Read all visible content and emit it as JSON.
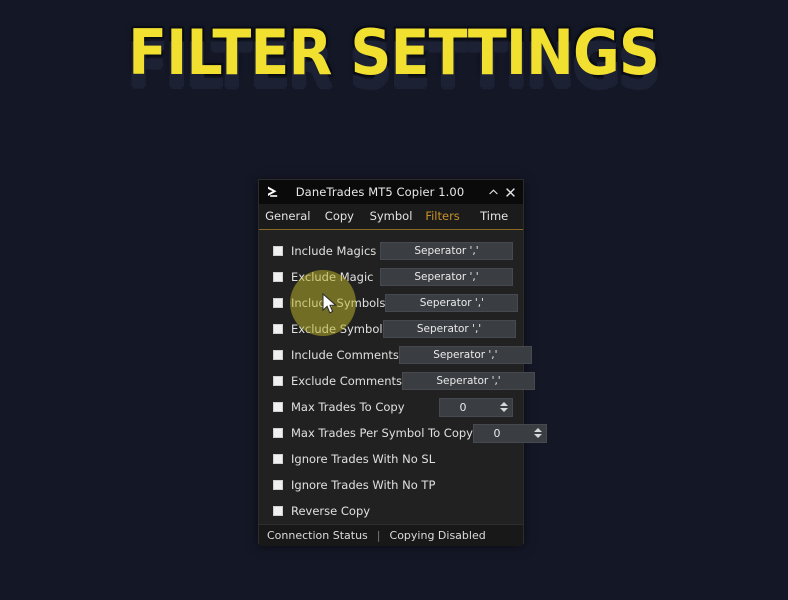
{
  "banner": {
    "title": "FILTER SETTINGS",
    "color": "#f2e030",
    "shadow_color": "#1d2134"
  },
  "page": {
    "background": "#141726"
  },
  "window": {
    "titlebar": {
      "logo_icon": "chevron-right-logo-icon",
      "title": "DaneTrades MT5 Copier 1.00",
      "collapse_icon": "chevron-up-icon",
      "close_icon": "close-x-icon"
    },
    "tabs": [
      {
        "label": "General",
        "active": false
      },
      {
        "label": "Copy",
        "active": false
      },
      {
        "label": "Symbol",
        "active": false
      },
      {
        "label": "Filters",
        "active": true
      },
      {
        "label": "Time",
        "active": false
      }
    ],
    "active_tab_color": "#c8922a",
    "background": "#212121",
    "rows": [
      {
        "label": "Include Magics",
        "checked": false,
        "control": "text",
        "value": "Seperator ','"
      },
      {
        "label": "Exclude Magic",
        "checked": false,
        "control": "text",
        "value": "Seperator ','"
      },
      {
        "label": "Include Symbols",
        "checked": false,
        "control": "text",
        "value": "Seperator ','"
      },
      {
        "label": "Exclude Symbol",
        "checked": false,
        "control": "text",
        "value": "Seperator ','"
      },
      {
        "label": "Include Comments",
        "checked": false,
        "control": "text",
        "value": "Seperator ','"
      },
      {
        "label": "Exclude Comments",
        "checked": false,
        "control": "text",
        "value": "Seperator ','"
      },
      {
        "label": "Max Trades To Copy",
        "checked": false,
        "control": "number",
        "value": "0"
      },
      {
        "label": "Max Trades Per Symbol To Copy",
        "checked": false,
        "control": "number",
        "value": "0"
      },
      {
        "label": "Ignore Trades With No SL",
        "checked": false,
        "control": "none",
        "value": ""
      },
      {
        "label": "Ignore Trades With No TP",
        "checked": false,
        "control": "none",
        "value": ""
      },
      {
        "label": "Reverse Copy",
        "checked": false,
        "control": "none",
        "value": ""
      }
    ],
    "statusbar": {
      "connection_label": "Connection Status",
      "divider": "|",
      "copy_state": "Copying Disabled"
    }
  },
  "pointer": {
    "cursor_icon": "mouse-arrow-cursor",
    "highlight_color": "#bdb428"
  }
}
